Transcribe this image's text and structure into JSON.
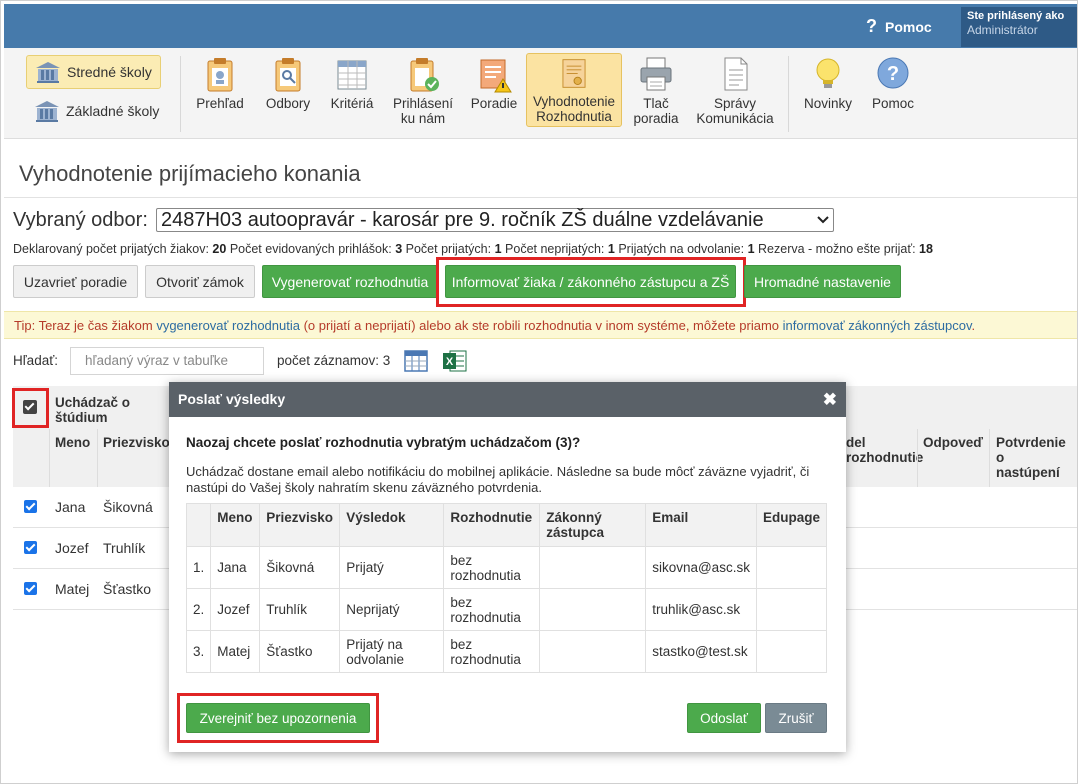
{
  "header": {
    "help_label": "Pomoc",
    "help_icon": "?",
    "user_line1": "Ste prihlásený ako",
    "user_line2": "Administrátor"
  },
  "schools": {
    "secondary": "Stredné školy",
    "primary": "Základné školy"
  },
  "toolbar": [
    {
      "id": "prehlad",
      "label": "Prehľad"
    },
    {
      "id": "odbory",
      "label": "Odbory"
    },
    {
      "id": "kriteria",
      "label": "Kritériá"
    },
    {
      "id": "prihlaseni",
      "label": "Prihlásení ku nám"
    },
    {
      "id": "poradie",
      "label": "Poradie"
    },
    {
      "id": "vyhodnotenie",
      "label": "Vyhodnotenie Rozhodnutia"
    },
    {
      "id": "tlac",
      "label": "Tlač poradia"
    },
    {
      "id": "spravy",
      "label": "Správy Komunikácia"
    },
    {
      "id": "novinky",
      "label": "Novinky"
    },
    {
      "id": "pomoc",
      "label": "Pomoc"
    }
  ],
  "page": {
    "title": "Vyhodnotenie prijímacieho konania",
    "odbor_label": "Vybraný odbor:",
    "odbor_value": "2487H03 autoopravár - karosár pre 9. ročník ZŠ duálne vzdelávanie",
    "stats": {
      "declared_label": "Deklarovaný počet prijatých žiakov:",
      "declared": "20",
      "registered_label": "Počet evidovaných prihlášok:",
      "registered": "3",
      "accepted_label": "Počet prijatých:",
      "accepted": "1",
      "rejected_label": "Počet neprijatých:",
      "rejected": "1",
      "appeal_label": "Prijatých na odvolanie:",
      "appeal": "1",
      "reserve_label": "Rezerva - možno ešte prijať:",
      "reserve": "18"
    },
    "buttons": {
      "close_order": "Uzavrieť poradie",
      "open_lock": "Otvoriť zámok",
      "generate": "Vygenerovať rozhodnutia",
      "inform": "Informovať žiaka / zákonného zástupcu a ZŠ",
      "bulk": "Hromadné nastavenie"
    },
    "tip": {
      "t1": "Tip: Teraz je čas žiakom ",
      "l1": "vygenerovať rozhodnutia",
      "t2": " (o prijatí a neprijatí) alebo ak ste robili rozhodnutia v inom systéme, môžete priamo ",
      "l2": "informovať zákonných zástupcov",
      "t3": "."
    },
    "search_label": "Hľadať:",
    "search_placeholder": "hľadaný výraz v tabuľke",
    "count_text": "počet záznamov: 3"
  },
  "table": {
    "group_header": "Uchádzač o štúdium",
    "headers": {
      "meno": "Meno",
      "priezvisko": "Priezvisko",
      "rozhodnutie": "del rozhodnutie",
      "odpoved": "Odpoveď",
      "potvrdenie": "Potvrdenie o nastúpení"
    },
    "rows": [
      {
        "meno": "Jana",
        "priezvisko": "Šikovná"
      },
      {
        "meno": "Jozef",
        "priezvisko": "Truhlík"
      },
      {
        "meno": "Matej",
        "priezvisko": "Šťastko"
      }
    ]
  },
  "modal": {
    "title": "Poslať výsledky",
    "close_icon": "✖",
    "question": "Naozaj chcete poslať rozhodnutia vybratým uchádzačom (3)?",
    "description": "Uchádzač dostane email alebo notifikáciu do mobilnej aplikácie. Následne sa bude môcť záväzne vyjadriť, či nastúpi do Vašej školy nahratím skenu záväzného potvrdenia.",
    "columns": [
      "",
      "Meno",
      "Priezvisko",
      "Výsledok",
      "Rozhodnutie",
      "Zákonný zástupca",
      "Email",
      "Edupage"
    ],
    "rows": [
      {
        "n": "1.",
        "meno": "Jana",
        "priezvisko": "Šikovná",
        "vysledok": "Prijatý",
        "vysledok_color": "green",
        "rozhodnutie": "bez rozhodnutia",
        "zastupca": "",
        "email": "sikovna@asc.sk",
        "edupage": ""
      },
      {
        "n": "2.",
        "meno": "Jozef",
        "priezvisko": "Truhlík",
        "vysledok": "Neprijatý",
        "vysledok_color": "red",
        "rozhodnutie": "bez rozhodnutia",
        "zastupca": "",
        "email": "truhlik@asc.sk",
        "edupage": ""
      },
      {
        "n": "3.",
        "meno": "Matej",
        "priezvisko": "Šťastko",
        "vysledok": "Prijatý na odvolanie",
        "vysledok_color": "green",
        "rozhodnutie": "bez rozhodnutia",
        "zastupca": "",
        "email": "stastko@test.sk",
        "edupage": ""
      }
    ],
    "btn_publish": "Zverejniť bez upozornenia",
    "btn_send": "Odoslať",
    "btn_cancel": "Zrušiť"
  },
  "colors": {
    "topbar": "#467aab",
    "green": "#4caa4c",
    "highlight_red": "#e02424",
    "modal_header": "#5a6168",
    "cancel_btn": "#7a8b95"
  }
}
